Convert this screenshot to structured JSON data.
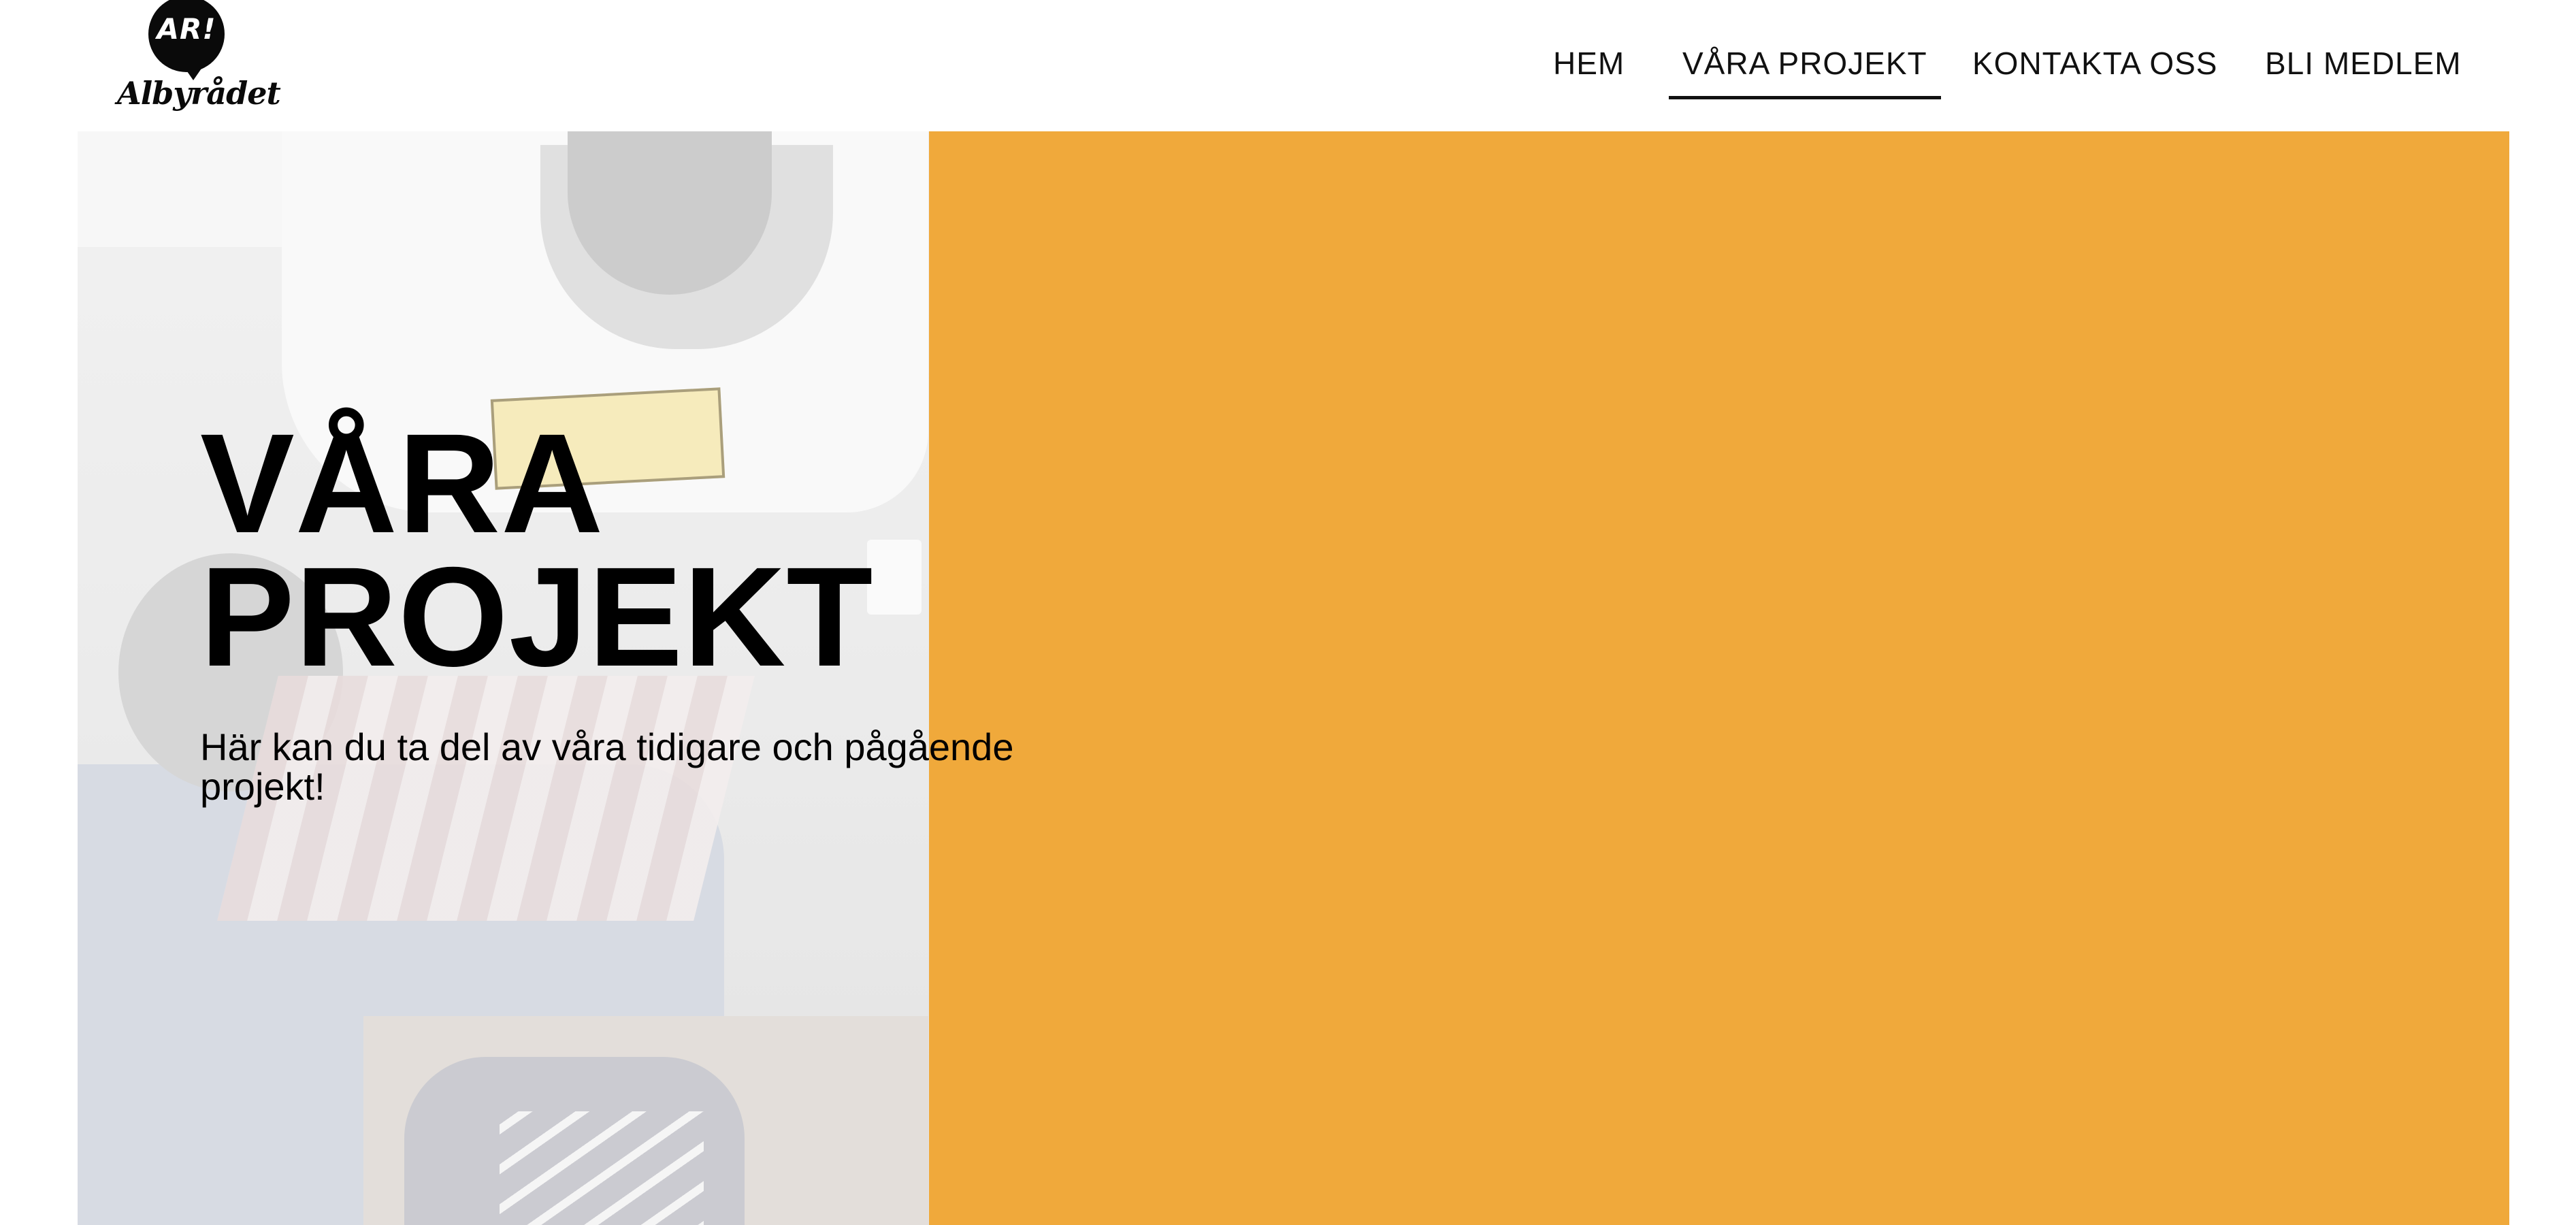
{
  "header": {
    "logo": {
      "mark_text": "AR!",
      "word_text": "Albyrådet"
    },
    "nav": [
      {
        "label": "HEM",
        "active": false
      },
      {
        "label": "VÅRA PROJEKT",
        "active": true
      },
      {
        "label": "KONTAKTA OSS",
        "active": false
      },
      {
        "label": "BLI MEDLEM",
        "active": false
      }
    ]
  },
  "hero": {
    "title_line1": "VÅRA",
    "title_line2": "PROJEKT",
    "subtitle": "Här kan du ta del av våra tidigare och pågående projekt!",
    "background_color": "#f0a93b"
  },
  "colors": {
    "accent": "#f0a93b",
    "text": "#000000"
  }
}
